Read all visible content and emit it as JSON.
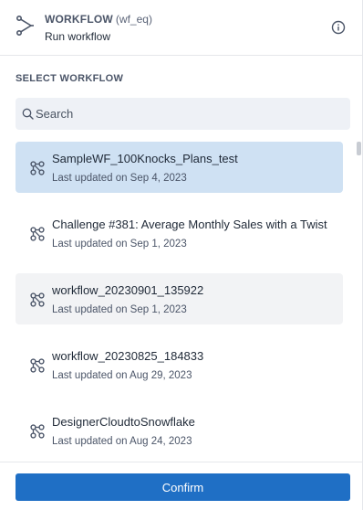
{
  "header": {
    "title": "WORKFLOW",
    "code": "(wf_eq)",
    "subtitle": "Run workflow",
    "icon": "workflow-icon",
    "info_icon": "info-icon"
  },
  "section_label": "SELECT WORKFLOW",
  "search": {
    "placeholder": "Search",
    "value": "",
    "icon": "search-icon"
  },
  "workflows": [
    {
      "name": "SampleWF_100Knocks_Plans_test",
      "updated": "Last updated on Sep 4, 2023",
      "state": "selected"
    },
    {
      "name": "Challenge #381: Average Monthly Sales with a Twist",
      "updated": "Last updated on Sep 1, 2023",
      "state": "normal"
    },
    {
      "name": "workflow_20230901_135922",
      "updated": "Last updated on Sep 1, 2023",
      "state": "hover"
    },
    {
      "name": "workflow_20230825_184833",
      "updated": "Last updated on Aug 29, 2023",
      "state": "normal"
    },
    {
      "name": "DesignerCloudtoSnowflake",
      "updated": "Last updated on Aug 24, 2023",
      "state": "normal"
    }
  ],
  "footer": {
    "confirm_label": "Confirm"
  },
  "colors": {
    "selected_bg": "#cfe1f3",
    "hover_bg": "#f2f3f5",
    "primary": "#1f6fc5",
    "search_bg": "#eef1f6"
  }
}
